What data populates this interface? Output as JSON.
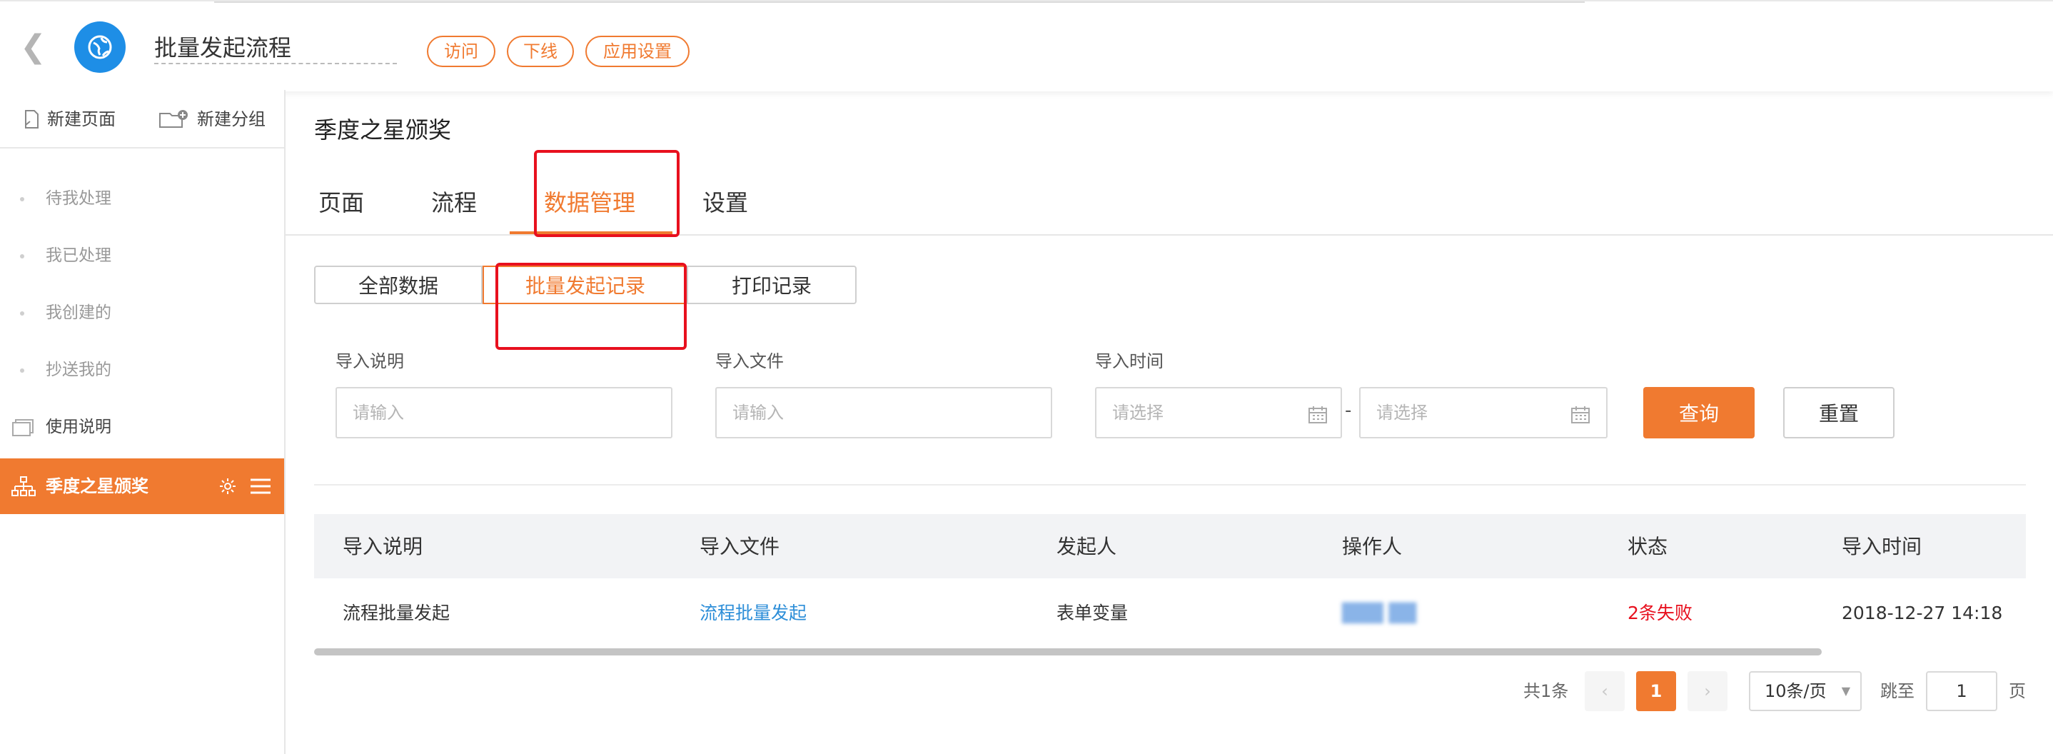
{
  "header": {
    "app_title": "批量发起流程",
    "buttons": [
      "访问",
      "下线",
      "应用设置"
    ]
  },
  "sidebar": {
    "new_page": "新建页面",
    "new_group": "新建分组",
    "items": [
      "待我处理",
      "我已处理",
      "我创建的",
      "抄送我的"
    ],
    "usage": "使用说明",
    "active_form": "季度之星颁奖"
  },
  "main": {
    "title": "季度之星颁奖",
    "tabs": [
      "页面",
      "流程",
      "数据管理",
      "设置"
    ],
    "active_tab": "数据管理",
    "sub_tabs": [
      "全部数据",
      "批量发起记录",
      "打印记录"
    ],
    "active_sub_tab": "批量发起记录"
  },
  "filters": {
    "desc_label": "导入说明",
    "desc_placeholder": "请输入",
    "file_label": "导入文件",
    "file_placeholder": "请输入",
    "time_label": "导入时间",
    "start_placeholder": "请选择",
    "end_placeholder": "请选择",
    "separator": "-",
    "query": "查询",
    "reset": "重置"
  },
  "table": {
    "columns": [
      "导入说明",
      "导入文件",
      "发起人",
      "操作人",
      "状态",
      "导入时间"
    ],
    "rows": [
      {
        "desc": "流程批量发起",
        "file": "流程批量发起",
        "initiator": "表单变量",
        "operator": "███ ██",
        "status": "2条失败",
        "time": "2018-12-27 14:18"
      }
    ]
  },
  "pagination": {
    "total": "共1条",
    "current": "1",
    "page_size": "10条/页",
    "jump_label": "跳至",
    "jump_value": "1",
    "page_suffix": "页"
  },
  "colors": {
    "accent": "#f07a30",
    "link": "#2d8ed8",
    "error": "#e8101e",
    "app_icon": "#1e8ee6"
  }
}
